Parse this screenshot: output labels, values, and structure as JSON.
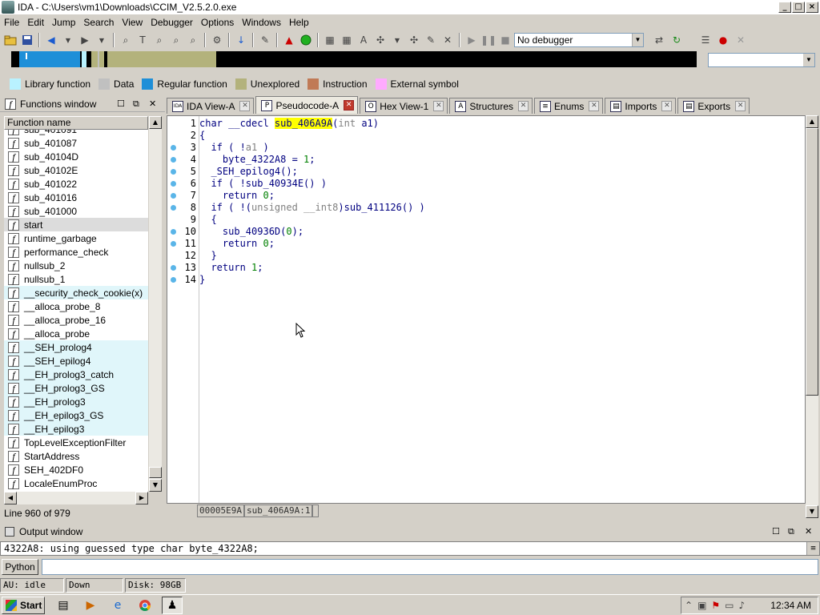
{
  "window": {
    "title": "IDA - C:\\Users\\vm1\\Downloads\\CCIM_V2.5.2.0.exe",
    "min": "_",
    "max": "□",
    "close": "×"
  },
  "menu": [
    "File",
    "Edit",
    "Jump",
    "Search",
    "View",
    "Debugger",
    "Options",
    "Windows",
    "Help"
  ],
  "toolbar": {
    "debugger_select": "No debugger"
  },
  "legend": [
    {
      "label": "Library function",
      "color": "#b9f2ff"
    },
    {
      "label": "Data",
      "color": "#c0c0c0"
    },
    {
      "label": "Regular function",
      "color": "#1e8fd8"
    },
    {
      "label": "Unexplored",
      "color": "#b3b27c"
    },
    {
      "label": "Instruction",
      "color": "#c07a56"
    },
    {
      "label": "External symbol",
      "color": "#ffaaff"
    }
  ],
  "functions": {
    "title": "Functions window",
    "column": "Function name",
    "items": [
      {
        "name": "sub_401091",
        "kind": "normal"
      },
      {
        "name": "sub_401087",
        "kind": "normal"
      },
      {
        "name": "sub_40104D",
        "kind": "normal"
      },
      {
        "name": "sub_40102E",
        "kind": "normal"
      },
      {
        "name": "sub_401022",
        "kind": "normal"
      },
      {
        "name": "sub_401016",
        "kind": "normal"
      },
      {
        "name": "sub_401000",
        "kind": "normal"
      },
      {
        "name": "start",
        "kind": "selected"
      },
      {
        "name": "runtime_garbage",
        "kind": "normal"
      },
      {
        "name": "performance_check",
        "kind": "normal"
      },
      {
        "name": "nullsub_2",
        "kind": "normal"
      },
      {
        "name": "nullsub_1",
        "kind": "normal"
      },
      {
        "name": "__security_check_cookie(x)",
        "kind": "library"
      },
      {
        "name": "__alloca_probe_8",
        "kind": "normal"
      },
      {
        "name": "__alloca_probe_16",
        "kind": "normal"
      },
      {
        "name": "__alloca_probe",
        "kind": "normal"
      },
      {
        "name": "__SEH_prolog4",
        "kind": "library"
      },
      {
        "name": "__SEH_epilog4",
        "kind": "library"
      },
      {
        "name": "__EH_prolog3_catch",
        "kind": "library"
      },
      {
        "name": "__EH_prolog3_GS",
        "kind": "library"
      },
      {
        "name": "__EH_prolog3",
        "kind": "library"
      },
      {
        "name": "__EH_epilog3_GS",
        "kind": "library"
      },
      {
        "name": "__EH_epilog3",
        "kind": "library"
      },
      {
        "name": "TopLevelExceptionFilter",
        "kind": "normal"
      },
      {
        "name": "StartAddress",
        "kind": "normal"
      },
      {
        "name": "SEH_402DF0",
        "kind": "normal"
      },
      {
        "name": "LocaleEnumProc",
        "kind": "normal"
      }
    ],
    "status": "Line 960 of 979"
  },
  "tabs": [
    {
      "label": "IDA View-A",
      "icon": "IDA",
      "active": false
    },
    {
      "label": "Pseudocode-A",
      "icon": "P",
      "active": true
    },
    {
      "label": "Hex View-1",
      "icon": "O",
      "active": false
    },
    {
      "label": "Structures",
      "icon": "A",
      "active": false
    },
    {
      "label": "Enums",
      "icon": "≡",
      "active": false
    },
    {
      "label": "Imports",
      "icon": "▤",
      "active": false
    },
    {
      "label": "Exports",
      "icon": "▤",
      "active": false
    }
  ],
  "code": {
    "lines": [
      {
        "n": "1",
        "dot": false
      },
      {
        "n": "2",
        "dot": false
      },
      {
        "n": "3",
        "dot": true
      },
      {
        "n": "4",
        "dot": true
      },
      {
        "n": "5",
        "dot": true
      },
      {
        "n": "6",
        "dot": true
      },
      {
        "n": "7",
        "dot": true
      },
      {
        "n": "8",
        "dot": true
      },
      {
        "n": "9",
        "dot": false
      },
      {
        "n": "10",
        "dot": true
      },
      {
        "n": "11",
        "dot": true
      },
      {
        "n": "12",
        "dot": false
      },
      {
        "n": "13",
        "dot": true
      },
      {
        "n": "14",
        "dot": true
      }
    ],
    "t": {
      "l1a": "char __cdecl ",
      "l1b": "sub_406A9A",
      "l1c": "(",
      "l1d": "int",
      "l1e": " a1)",
      "l2": "{",
      "l3a": "  if ( !",
      "l3b": "a1",
      "l3c": " )",
      "l4a": "    byte_4322A8 = ",
      "l4b": "1",
      "l4c": ";",
      "l5": "  _SEH_epilog4();",
      "l6": "  if ( !sub_40934E() )",
      "l7a": "    return ",
      "l7b": "0",
      "l7c": ";",
      "l8a": "  if ( !(",
      "l8b": "unsigned __int8",
      "l8c": ")sub_411126() )",
      "l9": "  {",
      "l10a": "    sub_40936D(",
      "l10b": "0",
      "l10c": ");",
      "l11a": "    return ",
      "l11b": "0",
      "l11c": ";",
      "l12": "  }",
      "l13a": "  return ",
      "l13b": "1",
      "l13c": ";",
      "l14": "}"
    },
    "status_addr": "00005E9A",
    "status_loc": "sub_406A9A:1"
  },
  "output": {
    "title": "Output window",
    "text": "4322A8: using guessed type char byte_4322A8;",
    "python_button": "Python"
  },
  "statusbar": {
    "au": "AU:  idle",
    "dir": "Down",
    "disk": "Disk: 98GB"
  },
  "taskbar": {
    "start": "Start",
    "clock": "12:34 AM"
  }
}
